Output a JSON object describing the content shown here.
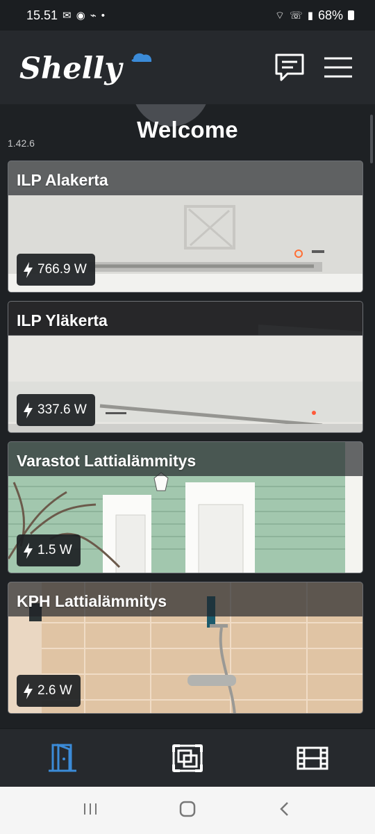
{
  "status_bar": {
    "time": "15.51",
    "battery": "68%",
    "left_icons": [
      "message-icon",
      "whatsapp-icon",
      "shield-icon",
      "dot-icon"
    ],
    "right_icons": [
      "wifi-icon",
      "call-icon",
      "signal-icon",
      "battery-icon"
    ]
  },
  "app": {
    "logo_text": "Shelly",
    "welcome": "Welcome",
    "version": "1.42.6",
    "header_icons": [
      "chat-icon",
      "menu-icon"
    ],
    "accent": "#3b8bd8"
  },
  "rooms": [
    {
      "name": "ILP Alakerta",
      "power": "766.9 W",
      "scene": "air-conditioner"
    },
    {
      "name": "ILP Yläkerta",
      "power": "337.6 W",
      "scene": "air-conditioner"
    },
    {
      "name": "Varastot Lattialämmitys",
      "power": "1.5 W",
      "scene": "house-exterior"
    },
    {
      "name": "KPH Lattialämmitys",
      "power": "2.6 W",
      "scene": "bathroom"
    }
  ],
  "bottom_nav": {
    "items": [
      "rooms-icon",
      "scenes-icon",
      "media-icon"
    ],
    "active": "rooms-icon"
  },
  "android_nav": [
    "recent-apps-icon",
    "home-icon",
    "back-icon"
  ]
}
